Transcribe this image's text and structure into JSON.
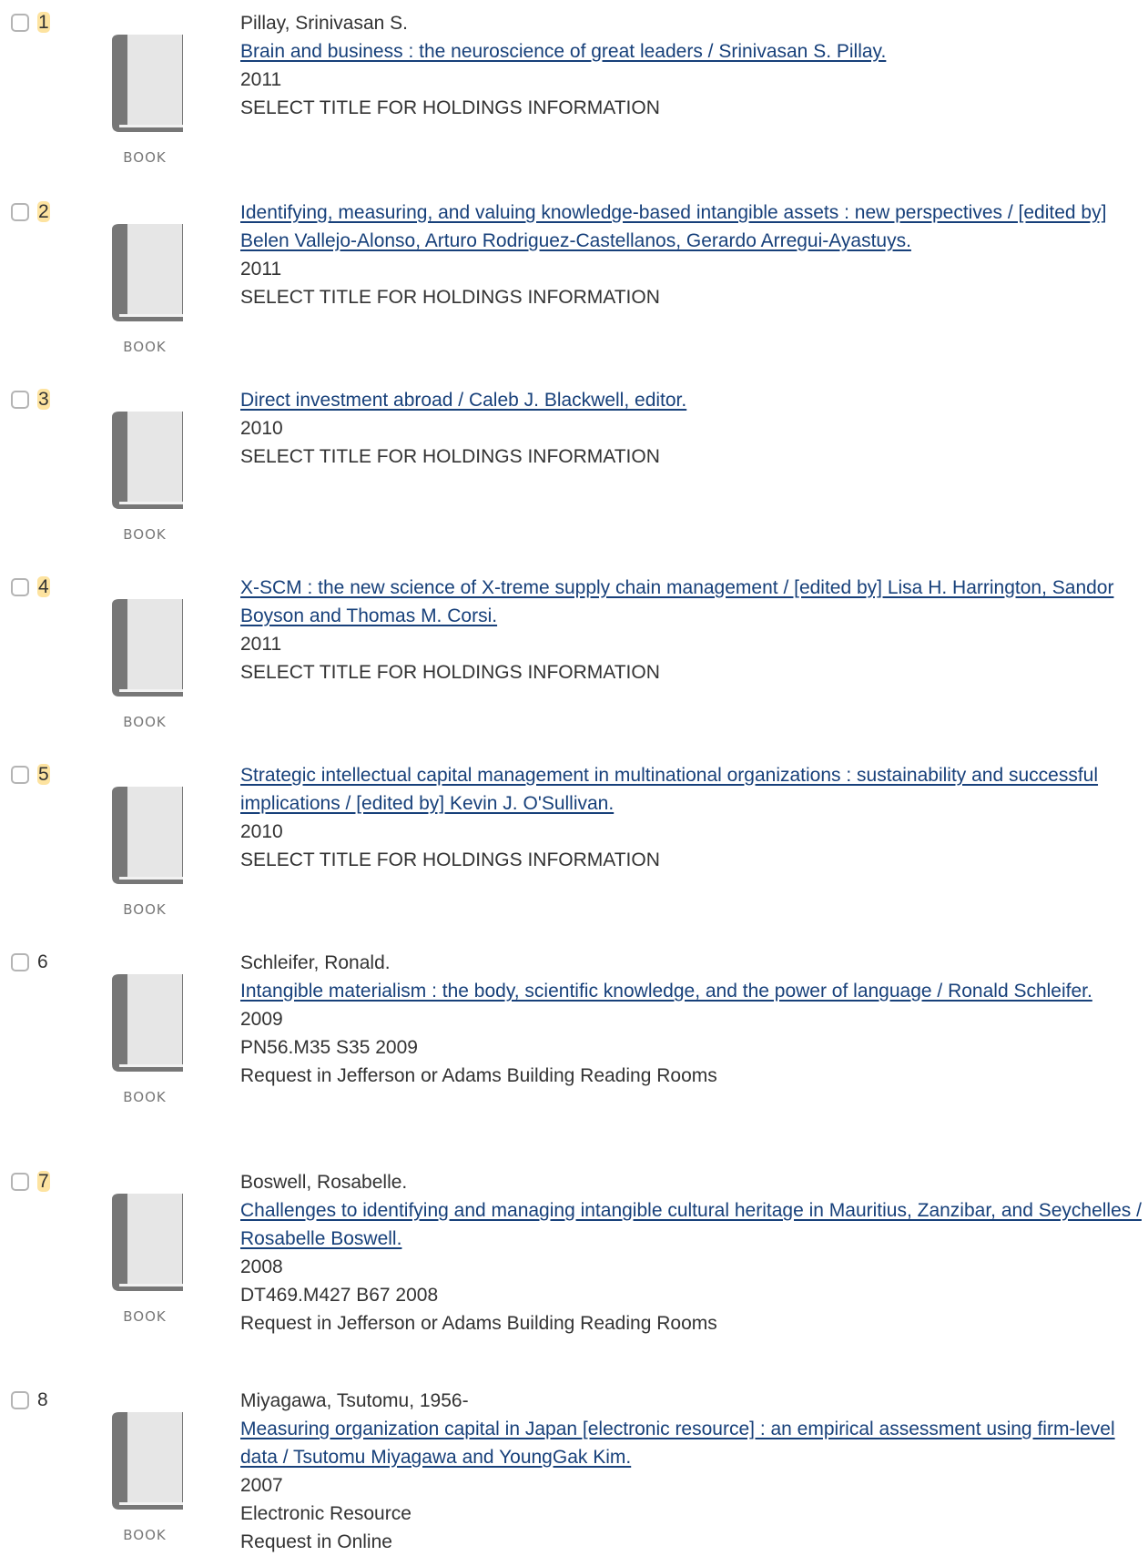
{
  "records": [
    {
      "number": "1",
      "format": "BOOK",
      "author": "Pillay, Srinivasan S.",
      "title": "Brain and business : the neuroscience of great leaders / Srinivasan S. Pillay.",
      "year": "2011",
      "holdings": "SELECT TITLE FOR HOLDINGS INFORMATION"
    },
    {
      "number": "2",
      "format": "BOOK",
      "title": "Identifying, measuring, and valuing knowledge-based intangible assets : new perspectives / [edited by] Belen Vallejo-Alonso, Arturo Rodriguez-Castellanos, Gerardo Arregui-Ayastuys.",
      "year": "2011",
      "holdings": "SELECT TITLE FOR HOLDINGS INFORMATION"
    },
    {
      "number": "3",
      "format": "BOOK",
      "title": "Direct investment abroad / Caleb J. Blackwell, editor.",
      "year": "2010",
      "holdings": "SELECT TITLE FOR HOLDINGS INFORMATION"
    },
    {
      "number": "4",
      "format": "BOOK",
      "title": "X-SCM : the new science of X-treme supply chain management / [edited by] Lisa H. Harrington, Sandor Boyson and Thomas M. Corsi.",
      "year": "2011",
      "holdings": "SELECT TITLE FOR HOLDINGS INFORMATION"
    },
    {
      "number": "5",
      "format": "BOOK",
      "title": "Strategic intellectual capital management in multinational organizations : sustainability and successful implications / [edited by] Kevin J. O'Sullivan.",
      "year": "2010",
      "holdings": "SELECT TITLE FOR HOLDINGS INFORMATION"
    },
    {
      "number": "6",
      "format": "BOOK",
      "author": "Schleifer, Ronald.",
      "title": "Intangible materialism : the body, scientific knowledge, and the power of language / Ronald Schleifer.",
      "year": "2009",
      "call_number": "PN56.M35 S35 2009",
      "holdings": "Request in Jefferson or Adams Building Reading Rooms"
    },
    {
      "number": "7",
      "format": "BOOK",
      "author": "Boswell, Rosabelle.",
      "title": "Challenges to identifying and managing intangible cultural heritage in Mauritius, Zanzibar, and Seychelles / Rosabelle Boswell.",
      "year": "2008",
      "call_number": "DT469.M427 B67 2008",
      "holdings": "Request in Jefferson or Adams Building Reading Rooms"
    },
    {
      "number": "8",
      "format": "BOOK",
      "author": "Miyagawa, Tsutomu, 1956-",
      "title": "Measuring organization capital in Japan [electronic resource] : an empirical assessment using firm-level data / Tsutomu Miyagawa and YoungGak Kim.",
      "year": "2007",
      "call_number": "Electronic Resource",
      "holdings": "Request in Online"
    }
  ],
  "colors": {
    "link": "#17407a",
    "text": "#333333",
    "number_highlight": "#fde3a0",
    "book_icon": "#777777"
  },
  "icons": {
    "thumbnail": "book-icon",
    "checkbox": "checkbox-icon"
  }
}
